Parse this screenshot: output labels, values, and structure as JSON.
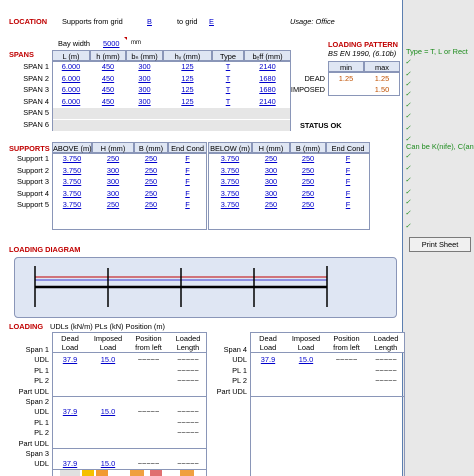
{
  "location": {
    "label": "LOCATION",
    "supports_from_grid": "Supports from grid",
    "from_grid": "B",
    "to_grid_label": "to grid",
    "to_grid": "E",
    "usage": "Usage: Office"
  },
  "spans": {
    "label": "SPANS",
    "bay_width_label": "Bay width",
    "bay_width": "5000",
    "bay_unit": "mm",
    "headers": [
      "L (m)",
      "h (mm)",
      "bₙ (mm)",
      "hᵥ (mm)",
      "Type",
      "bₑff (mm)"
    ],
    "rows": [
      {
        "label": "SPAN 1",
        "L": "6.000",
        "h": "450",
        "bw": "300",
        "hf": "125",
        "type": "T",
        "beff": "2140"
      },
      {
        "label": "SPAN 2",
        "L": "6.000",
        "h": "450",
        "bw": "300",
        "hf": "125",
        "type": "T",
        "beff": "1680"
      },
      {
        "label": "SPAN 3",
        "L": "6.000",
        "h": "450",
        "bw": "300",
        "hf": "125",
        "type": "T",
        "beff": "1680"
      },
      {
        "label": "SPAN 4",
        "L": "6.000",
        "h": "450",
        "bw": "300",
        "hf": "125",
        "type": "T",
        "beff": "2140"
      },
      {
        "label": "SPAN 5",
        "L": "",
        "h": "",
        "bw": "",
        "hf": "",
        "type": "",
        "beff": ""
      },
      {
        "label": "SPAN 6",
        "L": "",
        "h": "",
        "bw": "",
        "hf": "",
        "type": "",
        "beff": ""
      }
    ],
    "status": "STATUS OK"
  },
  "loading_pattern": {
    "label": "LOADING PATTERN",
    "code": "BS EN 1990, (6.10b)",
    "min_label": "min",
    "max_label": "max",
    "rows": [
      {
        "label": "DEAD",
        "min": "1.25",
        "max": "1.25"
      },
      {
        "label": "IMPOSED",
        "min": "",
        "max": "1.50"
      }
    ]
  },
  "supports": {
    "label": "SUPPORTS",
    "above_headers": [
      "ABOVE (m)",
      "H (mm)",
      "B (mm)",
      "End Cond"
    ],
    "below_headers": [
      "BELOW (m)",
      "H (mm)",
      "B (mm)",
      "End Cond"
    ],
    "rows": [
      {
        "label": "Support 1",
        "a": "3.750",
        "ah": "250",
        "ab": "250",
        "ac": "F",
        "b": "3.750",
        "bh": "250",
        "bb": "250",
        "bc": "F"
      },
      {
        "label": "Support 2",
        "a": "3.750",
        "ah": "300",
        "ab": "250",
        "ac": "F",
        "b": "3.750",
        "bh": "300",
        "bb": "250",
        "bc": "F"
      },
      {
        "label": "Support 3",
        "a": "3.750",
        "ah": "300",
        "ab": "250",
        "ac": "F",
        "b": "3.750",
        "bh": "300",
        "bb": "250",
        "bc": "F"
      },
      {
        "label": "Support 4",
        "a": "3.750",
        "ah": "300",
        "ab": "250",
        "ac": "F",
        "b": "3.750",
        "bh": "300",
        "bb": "250",
        "bc": "F"
      },
      {
        "label": "Support 5",
        "a": "3.750",
        "ah": "250",
        "ab": "250",
        "ac": "F",
        "b": "3.750",
        "bh": "250",
        "bb": "250",
        "bc": "F"
      }
    ]
  },
  "loading_diagram": {
    "label": "LOADING DIAGRAM"
  },
  "loading": {
    "label": "LOADING",
    "units": "UDLs (kN/m)   PLs (kN)   Position (m)",
    "headers": [
      [
        "Dead",
        "Load"
      ],
      [
        "Imposed",
        "Load"
      ],
      [
        "Position",
        "from left"
      ],
      [
        "Loaded",
        "Length"
      ]
    ],
    "left": [
      {
        "span": "Span 1",
        "rows": [
          {
            "label": "UDL",
            "dead": "37.9",
            "imposed": "15.0",
            "pos": "~~~~~",
            "len": "~~~~~"
          },
          {
            "label": "PL 1",
            "dead": "",
            "imposed": "",
            "pos": "",
            "len": "~~~~~"
          },
          {
            "label": "PL 2",
            "dead": "",
            "imposed": "",
            "pos": "",
            "len": "~~~~~"
          },
          {
            "label": "Part UDL",
            "dead": "",
            "imposed": "",
            "pos": "",
            "len": ""
          }
        ]
      },
      {
        "span": "Span 2",
        "rows": [
          {
            "label": "UDL",
            "dead": "37.9",
            "imposed": "15.0",
            "pos": "~~~~~",
            "len": "~~~~~"
          },
          {
            "label": "PL 1",
            "dead": "",
            "imposed": "",
            "pos": "",
            "len": "~~~~~"
          },
          {
            "label": "PL 2",
            "dead": "",
            "imposed": "",
            "pos": "",
            "len": "~~~~~"
          },
          {
            "label": "Part UDL",
            "dead": "",
            "imposed": "",
            "pos": "",
            "len": ""
          }
        ]
      },
      {
        "span": "Span 3",
        "rows": [
          {
            "label": "UDL",
            "dead": "37.9",
            "imposed": "15.0",
            "pos": "~~~~~",
            "len": "~~~~~"
          }
        ]
      }
    ],
    "right": [
      {
        "span": "Span 4",
        "rows": [
          {
            "label": "UDL",
            "dead": "37.9",
            "imposed": "15.0",
            "pos": "~~~~~",
            "len": "~~~~~"
          },
          {
            "label": "PL 1",
            "dead": "",
            "imposed": "",
            "pos": "",
            "len": "~~~~~"
          },
          {
            "label": "PL 2",
            "dead": "",
            "imposed": "",
            "pos": "",
            "len": "~~~~~"
          },
          {
            "label": "Part UDL",
            "dead": "",
            "imposed": "",
            "pos": "",
            "len": ""
          }
        ]
      }
    ]
  },
  "side": {
    "type_note": "Type = T, L or Rect",
    "cond_note": "Can be K(nife), C(ant)",
    "tick": "✓",
    "print_button": "Print Sheet"
  },
  "colors": {
    "section_red": "#c00000",
    "link_blue": "#0000cc",
    "header_fill": "#dfe6f3",
    "diagram_fill": "#dfe6f3",
    "beam": "#000000",
    "load_line": "#c00000"
  }
}
